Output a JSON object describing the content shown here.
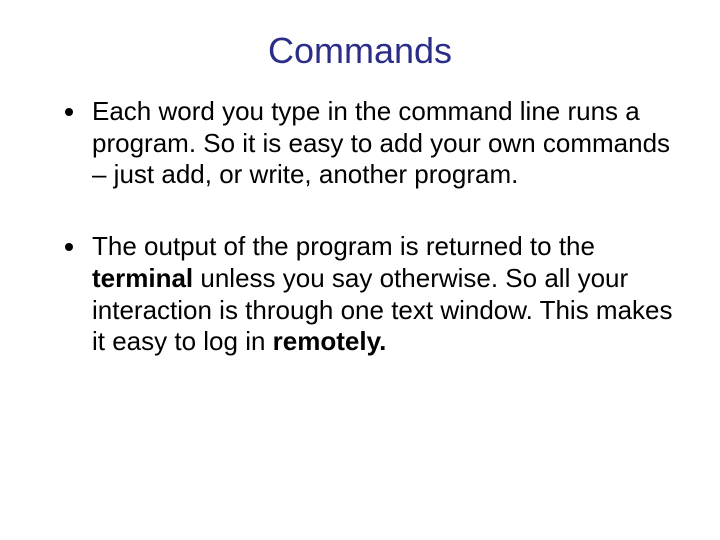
{
  "slide": {
    "title": "Commands",
    "bullets": [
      {
        "segments": [
          {
            "text": "Each word you type in the command line runs a program. So it is easy to add your own commands – just add, or write, another program.",
            "bold": false
          }
        ]
      },
      {
        "segments": [
          {
            "text": "The output of the program is returned to the ",
            "bold": false
          },
          {
            "text": "terminal",
            "bold": true
          },
          {
            "text": " unless you say otherwise. So all your interaction is through one text window. This makes it easy to log in ",
            "bold": false
          },
          {
            "text": "remotely.",
            "bold": true
          }
        ]
      }
    ]
  },
  "colors": {
    "title_color": "#2b2e86",
    "background": "#ffffff",
    "text": "#000000"
  }
}
